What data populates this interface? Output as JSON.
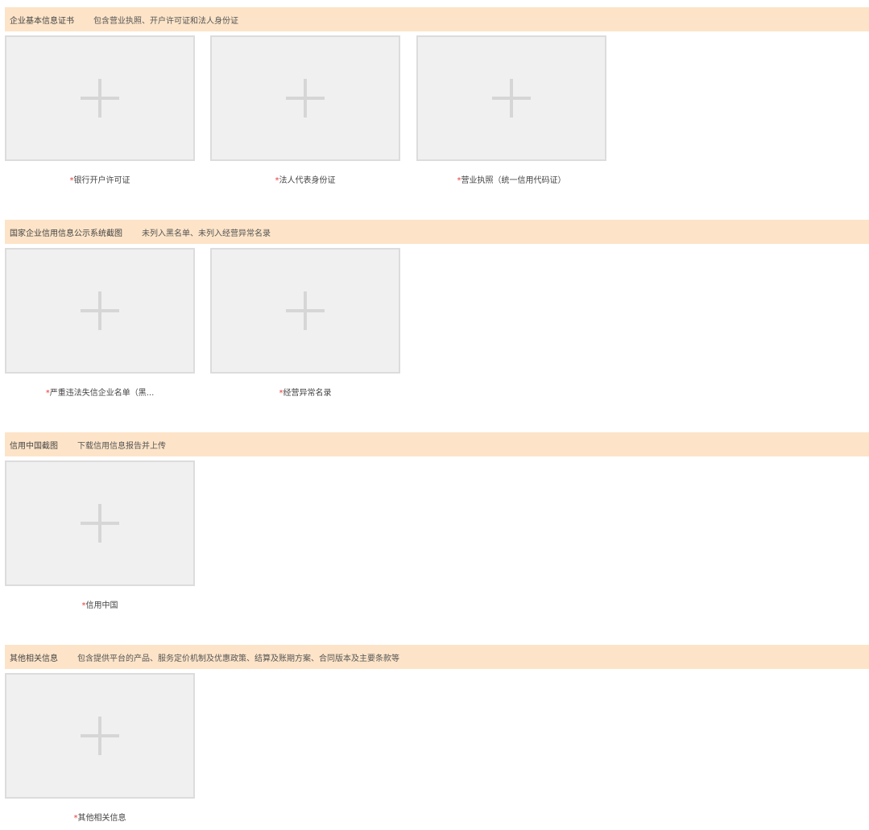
{
  "sections": [
    {
      "title": "企业基本信息证书",
      "desc": "包含营业执照、开户许可证和法人身份证",
      "items": [
        {
          "required": "*",
          "label": "银行开户许可证"
        },
        {
          "required": "*",
          "label": "法人代表身份证"
        },
        {
          "required": "*",
          "label": "营业执照（统一信用代码证）"
        }
      ]
    },
    {
      "title": "国家企业信用信息公示系统截图",
      "desc": "未列入黑名单、未列入经营异常名录",
      "items": [
        {
          "required": "*",
          "label": "严重违法失信企业名单（黑..."
        },
        {
          "required": "*",
          "label": "经营异常名录"
        }
      ]
    },
    {
      "title": "信用中国截图",
      "desc": "下载信用信息报告并上传",
      "items": [
        {
          "required": "*",
          "label": "信用中国"
        }
      ]
    },
    {
      "title": "其他相关信息",
      "desc": "包含提供平台的产品、服务定价机制及优惠政策、结算及账期方案、合同版本及主要条款等",
      "items": [
        {
          "required": "*",
          "label": "其他相关信息"
        }
      ]
    }
  ]
}
